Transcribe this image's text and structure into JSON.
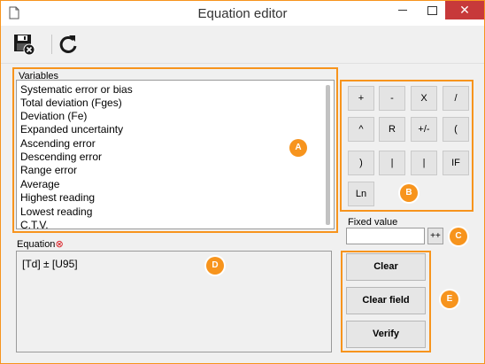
{
  "window": {
    "title": "Equation editor",
    "close_glyph": "✕"
  },
  "toolbar": {
    "save_icon": "save-with-x-icon",
    "refresh_icon": "refresh-icon"
  },
  "variables": {
    "label": "Variables",
    "items": [
      "Systematic error or bias",
      "Total deviation (Fges)",
      "Deviation (Fe)",
      "Expanded uncertainty",
      "Ascending error",
      "Descending error",
      "Range error",
      "Average",
      "Highest reading",
      "Lowest reading",
      "C.T.V."
    ]
  },
  "calc_buttons": [
    "+",
    "-",
    "X",
    "/",
    "^",
    "R",
    "+/-",
    "(",
    ")",
    "|",
    "|",
    "IF",
    "Ln"
  ],
  "fixed_value": {
    "label": "Fixed value",
    "value": "",
    "add_label": "++"
  },
  "equation": {
    "label": "Equation",
    "required_mark": "⊗",
    "value": "[Td] ± [U95]"
  },
  "actions": {
    "clear": "Clear",
    "clear_field": "Clear field",
    "verify": "Verify"
  },
  "badges": {
    "a": "A",
    "b": "B",
    "c": "C",
    "d": "D",
    "e": "E"
  },
  "colors": {
    "accent": "#f7941d",
    "close_button": "#c7393a"
  }
}
